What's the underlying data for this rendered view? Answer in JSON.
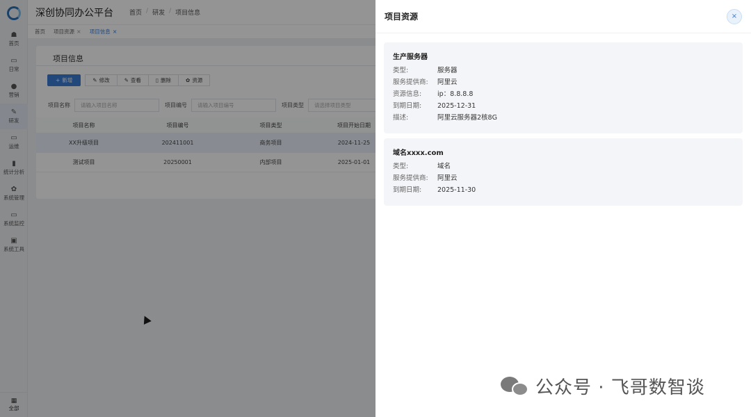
{
  "app": {
    "title": "深创协同办公平台"
  },
  "breadcrumb": [
    "首页",
    "研发",
    "项目信息"
  ],
  "sidebar": {
    "items": [
      {
        "label": "首页",
        "icon": "dashboard-icon"
      },
      {
        "label": "日常",
        "icon": "calendar-icon"
      },
      {
        "label": "营销",
        "icon": "globe-icon"
      },
      {
        "label": "研发",
        "icon": "edit-icon"
      },
      {
        "label": "运维",
        "icon": "monitor-icon"
      },
      {
        "label": "统计分析",
        "icon": "bar-chart-icon"
      },
      {
        "label": "系统管理",
        "icon": "gear-icon"
      },
      {
        "label": "系统监控",
        "icon": "monitor-icon"
      },
      {
        "label": "系统工具",
        "icon": "toolbox-icon"
      }
    ],
    "bottom": {
      "label": "全部",
      "icon": "grid-icon"
    }
  },
  "tags": [
    {
      "label": "首页",
      "closable": false
    },
    {
      "label": "项目资源",
      "closable": true
    },
    {
      "label": "项目信息",
      "closable": true,
      "active": true
    }
  ],
  "card": {
    "tab_title": "项目信息"
  },
  "toolbar": {
    "add": "新增",
    "edit": "修改",
    "view": "查看",
    "delete": "删除",
    "resource": "资源"
  },
  "filters": [
    {
      "label": "项目名称",
      "placeholder": "请输入项目名称"
    },
    {
      "label": "项目编号",
      "placeholder": "请输入项目编号"
    },
    {
      "label": "项目类型",
      "placeholder": "请选择项目类型"
    }
  ],
  "table": {
    "headers": [
      "项目名称",
      "项目编号",
      "项目类型",
      "项目开始日期"
    ],
    "rows": [
      [
        "XX升级项目",
        "202411001",
        "商务项目",
        "2024-11-25"
      ],
      [
        "测试项目",
        "20250001",
        "内部项目",
        "2025-01-01"
      ]
    ]
  },
  "drawer": {
    "title": "项目资源",
    "resources": [
      {
        "name": "生产服务器",
        "fields": [
          {
            "k": "类型:",
            "v": "服务器"
          },
          {
            "k": "服务提供商:",
            "v": "阿里云"
          },
          {
            "k": "资源信息:",
            "v": "ip：8.8.8.8"
          },
          {
            "k": "到期日期:",
            "v": "2025-12-31"
          },
          {
            "k": "描述:",
            "v": "阿里云服务器2核8G"
          }
        ]
      },
      {
        "name": "域名xxxx.com",
        "fields": [
          {
            "k": "类型:",
            "v": "域名"
          },
          {
            "k": "服务提供商:",
            "v": "阿里云"
          },
          {
            "k": "到期日期:",
            "v": "2025-11-30"
          }
        ]
      }
    ]
  },
  "watermark": {
    "text": "公众号 · 飞哥数智谈"
  },
  "colors": {
    "accent": "#3a7bd5",
    "overlay": "rgba(0,0,0,0.42)"
  }
}
